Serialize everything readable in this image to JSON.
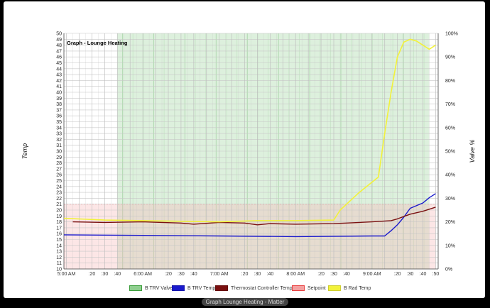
{
  "chart_data": {
    "type": "line",
    "title": "Graph - Lounge Heating",
    "ylabel": "Temp",
    "y2label": "Valve %",
    "ylim": [
      10,
      50
    ],
    "y2lim": [
      0,
      100
    ],
    "y_ticks": [
      10,
      11,
      12,
      13,
      14,
      15,
      16,
      17,
      18,
      19,
      20,
      21,
      22,
      23,
      24,
      25,
      26,
      27,
      28,
      29,
      30,
      31,
      32,
      33,
      34,
      35,
      36,
      37,
      38,
      39,
      40,
      41,
      42,
      43,
      44,
      45,
      46,
      47,
      48,
      49,
      50
    ],
    "y2_ticks": [
      "0%",
      "10%",
      "20%",
      "30%",
      "40%",
      "50%",
      "60%",
      "70%",
      "80%",
      "90%",
      "100%"
    ],
    "x_ticks": [
      "5:00 AM",
      ":20",
      ":30",
      ":40",
      "6:00 AM",
      ":20",
      ":30",
      ":40",
      "7:00 AM",
      ":20",
      ":30",
      ":40",
      "8:00 AM",
      ":20",
      ":30",
      ":40",
      "9:00 AM",
      ":20",
      ":30",
      ":40",
      ":50"
    ],
    "grid": true,
    "legend_position": "bottom",
    "series": [
      {
        "name": "B TRV Valve",
        "color": "#3c9e3c",
        "segments": [
          {
            "start": "5:40 AM",
            "end": "9:45 AM",
            "value": 100
          }
        ],
        "note": "stepped valve %"
      },
      {
        "name": "B TRV Temp",
        "color": "#1a1acc",
        "x": [
          "4:58 AM",
          "6:00 AM",
          "7:00 AM",
          "8:00 AM",
          "9:00 AM",
          "9:10 AM",
          "9:15 AM",
          "9:20 AM",
          "9:25 AM",
          "9:30 AM",
          "9:40 AM",
          "9:45 AM",
          "9:50 AM"
        ],
        "values": [
          15.8,
          15.7,
          15.6,
          15.5,
          15.6,
          15.6,
          16.5,
          17.5,
          18.8,
          20.3,
          21.2,
          22.1,
          22.8
        ]
      },
      {
        "name": "Thermostat Controller Temp",
        "color": "#7a1010",
        "x": [
          "5:05 AM",
          "5:30 AM",
          "6:00 AM",
          "6:30 AM",
          "6:40 AM",
          "7:00 AM",
          "7:20 AM",
          "7:30 AM",
          "7:40 AM",
          "8:00 AM",
          "8:30 AM",
          "8:40 AM",
          "9:00 AM",
          "9:15 AM",
          "9:20 AM",
          "9:30 AM",
          "9:40 AM",
          "9:50 AM"
        ],
        "values": [
          18.0,
          17.9,
          18.0,
          17.8,
          17.6,
          17.9,
          17.8,
          17.5,
          17.7,
          17.6,
          17.7,
          17.8,
          18.0,
          18.2,
          18.5,
          19.3,
          19.8,
          20.5
        ]
      },
      {
        "name": "Setpoint",
        "color": "#e84040",
        "segments": [
          {
            "start": "4:58 AM",
            "end": "9:50 AM",
            "value": 21
          }
        ]
      },
      {
        "name": "B Rad Temp",
        "color": "#f2f23a",
        "x": [
          "4:58 AM",
          "5:30 AM",
          "6:00 AM",
          "6:30 AM",
          "7:00 AM",
          "7:30 AM",
          "8:00 AM",
          "8:30 AM",
          "8:35 AM",
          "8:50 AM",
          "9:05 AM",
          "9:10 AM",
          "9:15 AM",
          "9:20 AM",
          "9:25 AM",
          "9:30 AM",
          "9:35 AM",
          "9:45 AM",
          "9:50 AM"
        ],
        "values": [
          18.6,
          18.3,
          18.2,
          18.1,
          18.0,
          18.2,
          18.2,
          18.3,
          20.0,
          23.0,
          25.6,
          33.0,
          40.0,
          46.0,
          48.5,
          49.0,
          48.7,
          47.3,
          48.0
        ]
      }
    ]
  },
  "legend": [
    {
      "label": "B TRV Valve",
      "color": "#3c9e3c",
      "fill": "#8fcf8f"
    },
    {
      "label": "B TRV Temp",
      "color": "#1a1acc",
      "fill": "#1a1acc"
    },
    {
      "label": "Thermostat Controller Temp",
      "color": "#7a1010",
      "fill": "#7a1010"
    },
    {
      "label": "Setpoint",
      "color": "#e84040",
      "fill": "#f4a0a0"
    },
    {
      "label": "B Rad Temp",
      "color": "#f2f23a",
      "fill": "#f2f23a"
    }
  ],
  "caption": "Graph Lounge Heating - Matter"
}
